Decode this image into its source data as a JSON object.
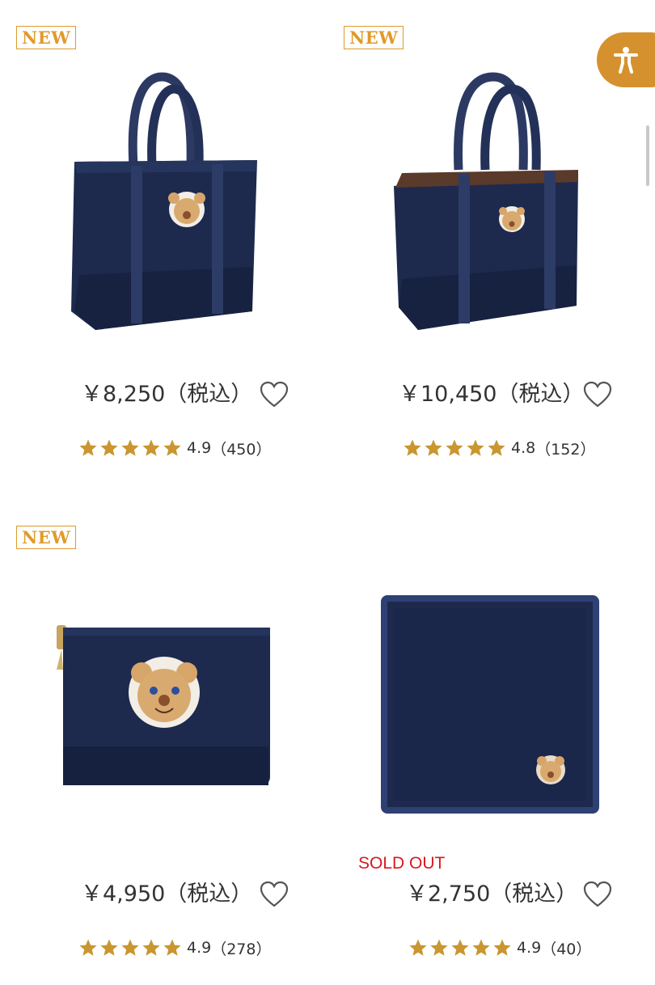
{
  "products": [
    {
      "badge": "NEW",
      "price": "￥8,250（税込）",
      "rating": "4.9",
      "reviews": "（450）",
      "name": "tote-bag-small"
    },
    {
      "badge": "NEW",
      "price": "￥10,450（税込）",
      "rating": "4.8",
      "reviews": "（152）",
      "name": "tote-bag-medium"
    },
    {
      "badge": "NEW",
      "price": "￥4,950（税込）",
      "rating": "4.9",
      "reviews": "（278）",
      "name": "pouch"
    },
    {
      "badge": "",
      "price": "￥2,750（税込）",
      "rating": "4.9",
      "reviews": "（40）",
      "name": "handkerchief",
      "status": "SOLD OUT"
    }
  ],
  "colors": {
    "accent": "#e09a2a",
    "star": "#c99630",
    "navy": "#1c2a4d",
    "sold_out": "#d71920"
  },
  "icons": {
    "favorite": "heart-outline-icon",
    "accessibility": "accessibility-person-icon",
    "star": "star-icon"
  }
}
